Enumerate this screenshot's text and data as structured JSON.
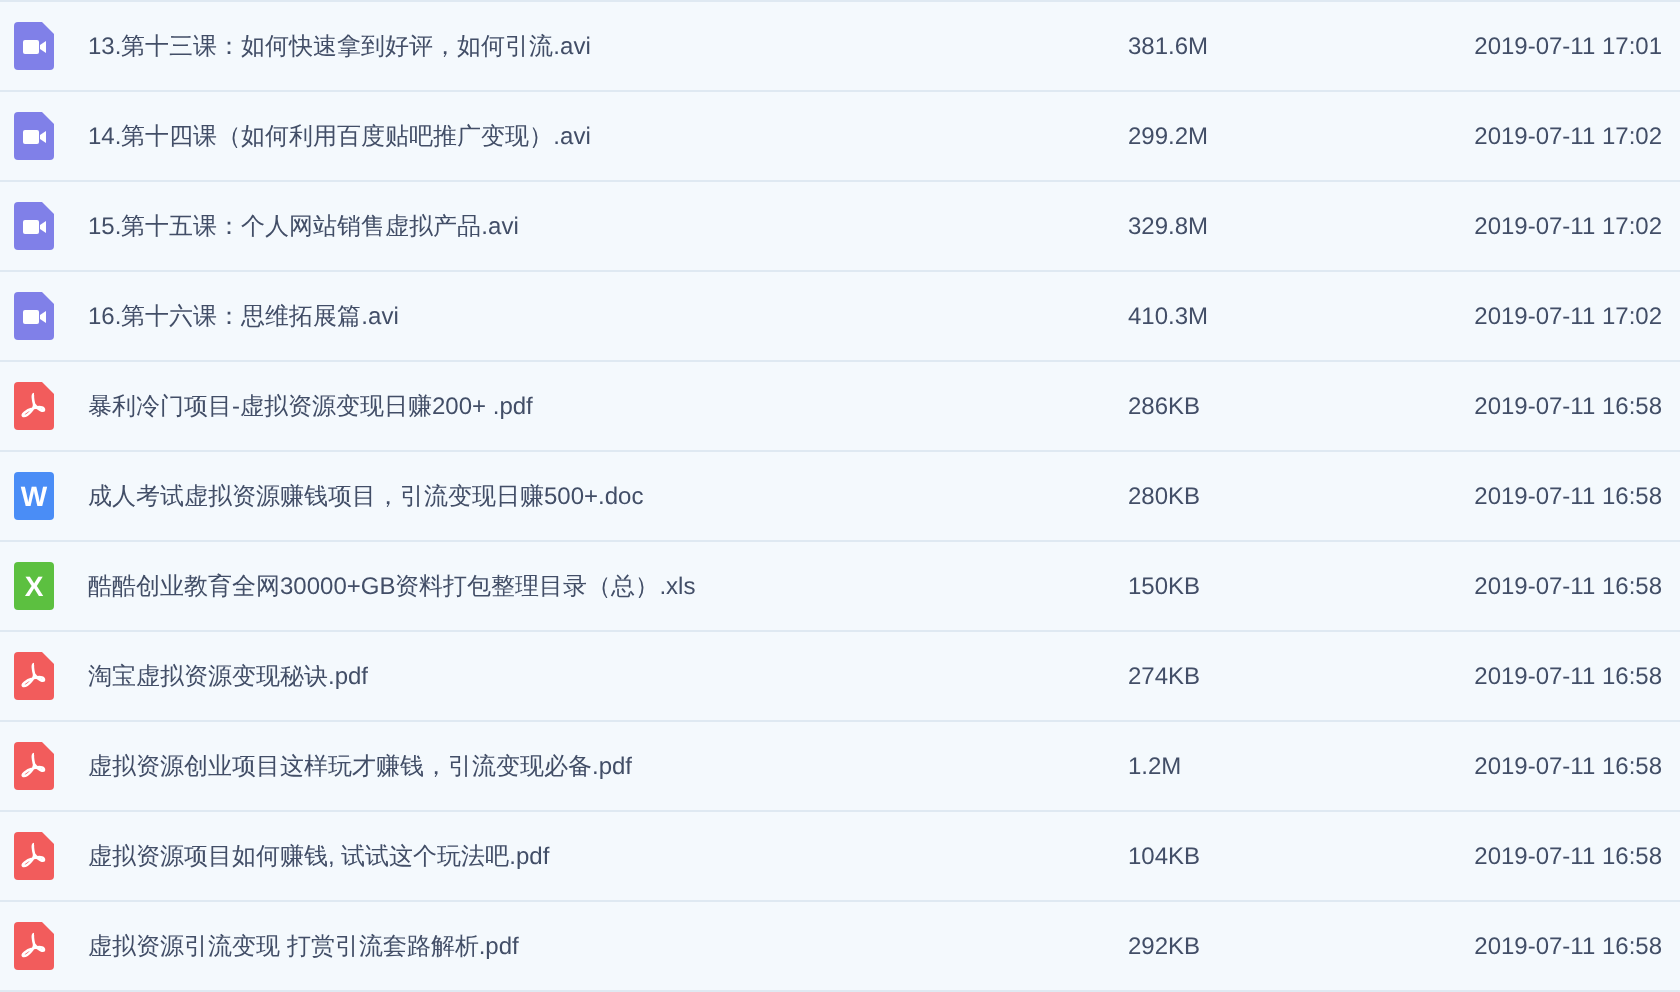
{
  "files": [
    {
      "kind": "video",
      "name": "13.第十三课：如何快速拿到好评，如何引流.avi",
      "size": "381.6M",
      "modified": "2019-07-11 17:01"
    },
    {
      "kind": "video",
      "name": "14.第十四课（如何利用百度贴吧推广变现）.avi",
      "size": "299.2M",
      "modified": "2019-07-11 17:02"
    },
    {
      "kind": "video",
      "name": "15.第十五课：个人网站销售虚拟产品.avi",
      "size": "329.8M",
      "modified": "2019-07-11 17:02"
    },
    {
      "kind": "video",
      "name": "16.第十六课：思维拓展篇.avi",
      "size": "410.3M",
      "modified": "2019-07-11 17:02"
    },
    {
      "kind": "pdf",
      "name": "暴利冷门项目-虚拟资源变现日赚200+ .pdf",
      "size": "286KB",
      "modified": "2019-07-11 16:58"
    },
    {
      "kind": "word",
      "glyph": "W",
      "name": "成人考试虚拟资源赚钱项目，引流变现日赚500+.doc",
      "size": "280KB",
      "modified": "2019-07-11 16:58"
    },
    {
      "kind": "excel",
      "glyph": "X",
      "name": "酷酷创业教育全网30000+GB资料打包整理目录（总）.xls",
      "size": "150KB",
      "modified": "2019-07-11 16:58"
    },
    {
      "kind": "pdf",
      "name": "淘宝虚拟资源变现秘诀.pdf",
      "size": "274KB",
      "modified": "2019-07-11 16:58"
    },
    {
      "kind": "pdf",
      "name": "虚拟资源创业项目这样玩才赚钱，引流变现必备.pdf",
      "size": "1.2M",
      "modified": "2019-07-11 16:58"
    },
    {
      "kind": "pdf",
      "name": "虚拟资源项目如何赚钱, 试试这个玩法吧.pdf",
      "size": "104KB",
      "modified": "2019-07-11 16:58"
    },
    {
      "kind": "pdf",
      "name": "虚拟资源引流变现 打赏引流套路解析.pdf",
      "size": "292KB",
      "modified": "2019-07-11 16:58"
    }
  ]
}
